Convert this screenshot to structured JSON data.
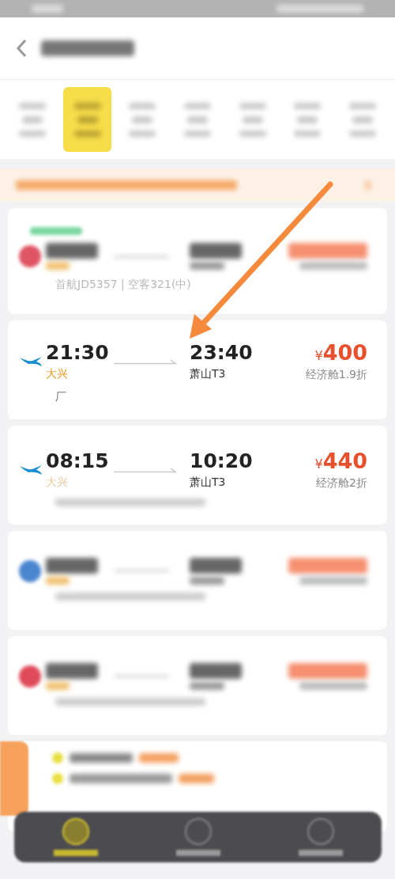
{
  "date_tabs": [
    {
      "selected": false
    },
    {
      "selected": true
    },
    {
      "selected": false
    },
    {
      "selected": false
    },
    {
      "selected": false
    },
    {
      "selected": false
    },
    {
      "selected": false
    }
  ],
  "flights": [
    {
      "kind": "blurred",
      "badge": true,
      "color": "#e05565",
      "note": "首航JD5357 | 空客321(中)"
    },
    {
      "kind": "clear",
      "color": "#1a8fd0",
      "dep_time": "21:30",
      "dep_airport": "大兴",
      "arr_time": "23:40",
      "arr_airport": "萧山T3",
      "currency": "¥",
      "price": "400",
      "cabin": "经济舱1.9折",
      "note": "厂"
    },
    {
      "kind": "clear",
      "color": "#1a8fd0",
      "dep_time": "08:15",
      "dep_airport": "大兴",
      "arr_time": "10:20",
      "arr_airport": "萧山T3",
      "currency": "¥",
      "price": "440",
      "cabin": "经济舱2折"
    },
    {
      "kind": "blurred",
      "badge": false,
      "color": "#4a86d0"
    },
    {
      "kind": "blurred",
      "badge": false,
      "color": "#e04a5a"
    }
  ],
  "bottom_nav": [
    {
      "selected": true
    },
    {
      "selected": false
    },
    {
      "selected": false
    }
  ],
  "annotation": {
    "kind": "arrow"
  }
}
